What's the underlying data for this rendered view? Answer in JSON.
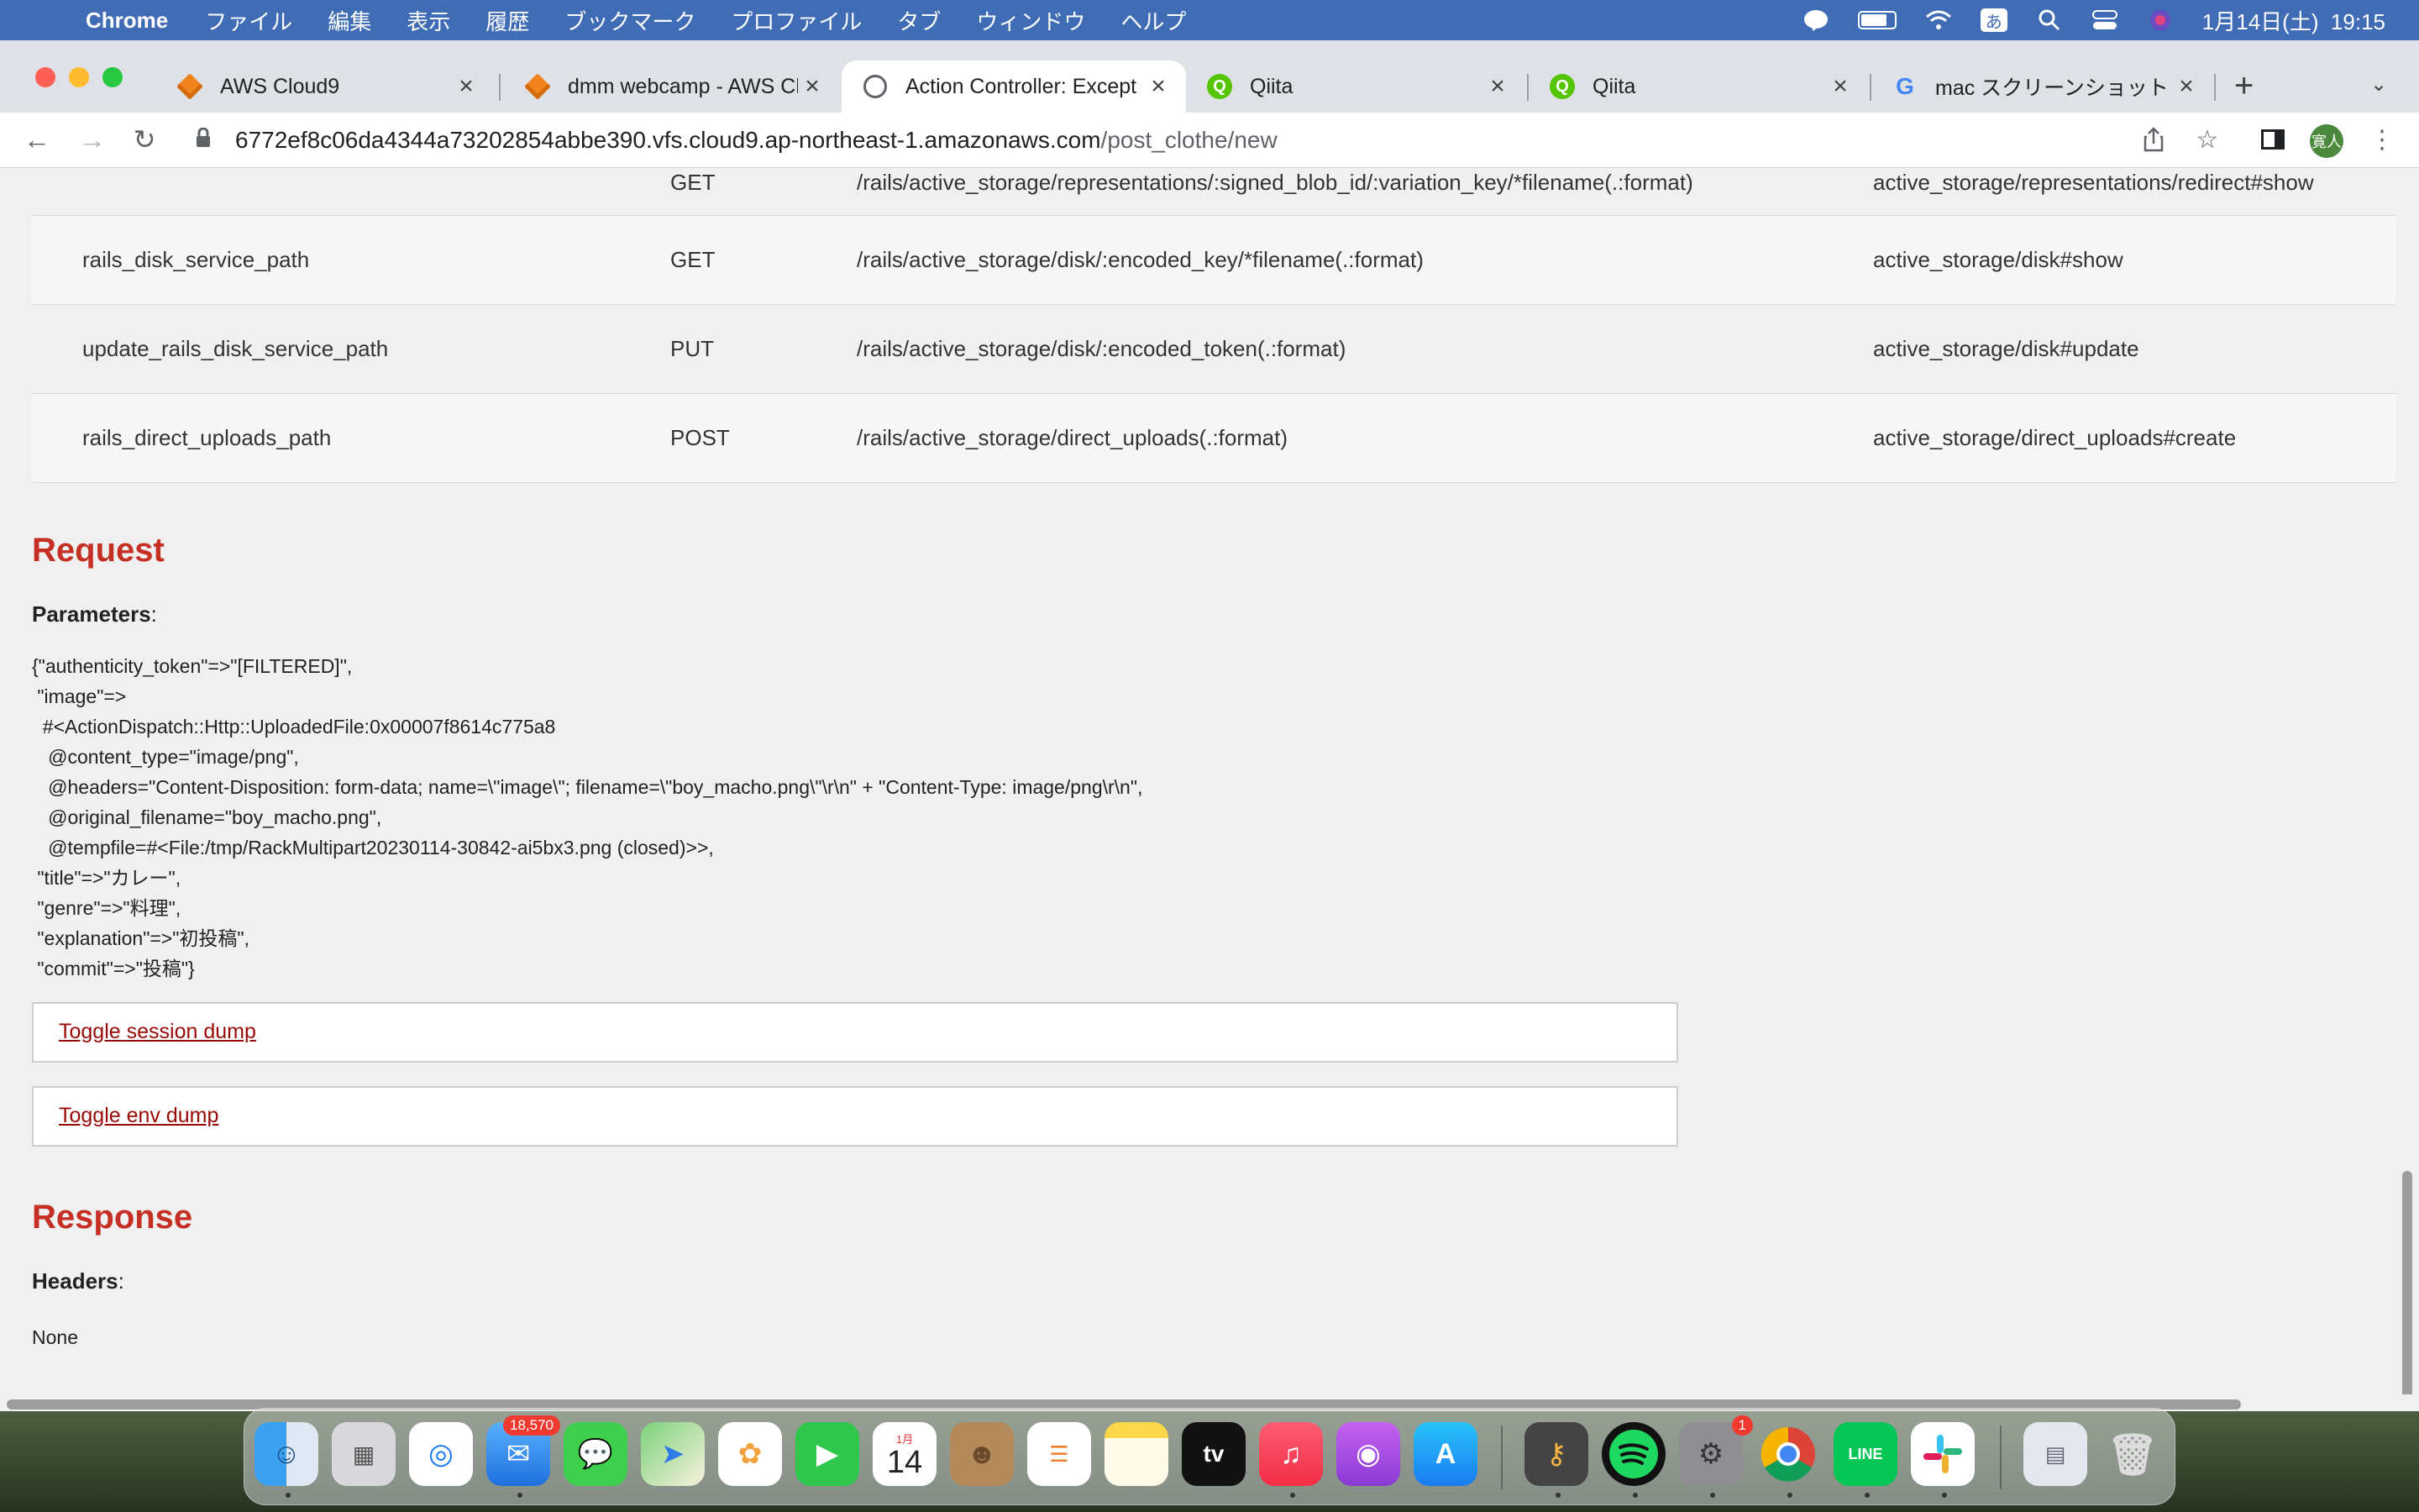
{
  "menubar": {
    "app": "Chrome",
    "items": [
      "ファイル",
      "編集",
      "表示",
      "履歴",
      "ブックマーク",
      "プロファイル",
      "タブ",
      "ウィンドウ",
      "ヘルプ"
    ],
    "ime": "あ",
    "datetime": "1月14日(土)  19:15"
  },
  "tabs": [
    {
      "label": "AWS Cloud9",
      "icon": "cloud9-icon"
    },
    {
      "label": "dmm webcamp - AWS Cl",
      "icon": "cloud9-icon"
    },
    {
      "label": "Action Controller: Except",
      "icon": "globe-icon"
    },
    {
      "label": "Qiita",
      "icon": "qiita-icon"
    },
    {
      "label": "Qiita",
      "icon": "qiita-icon"
    },
    {
      "label": "mac スクリーンショット -",
      "icon": "google-icon"
    }
  ],
  "omnibox": {
    "host": "6772ef8c06da4344a73202854abbe390.vfs.cloud9.ap-northeast-1.amazonaws.com",
    "path": "/post_clothe/new"
  },
  "profile_initials": "寛人",
  "routes": [
    {
      "helper": "",
      "verb": "GET",
      "path": "/rails/active_storage/representations/:signed_blob_id/:variation_key/*filename(.:format)",
      "action": "active_storage/representations/redirect#show"
    },
    {
      "helper": "rails_disk_service_path",
      "verb": "GET",
      "path": "/rails/active_storage/disk/:encoded_key/*filename(.:format)",
      "action": "active_storage/disk#show"
    },
    {
      "helper": "update_rails_disk_service_path",
      "verb": "PUT",
      "path": "/rails/active_storage/disk/:encoded_token(.:format)",
      "action": "active_storage/disk#update"
    },
    {
      "helper": "rails_direct_uploads_path",
      "verb": "POST",
      "path": "/rails/active_storage/direct_uploads(.:format)",
      "action": "active_storage/direct_uploads#create"
    }
  ],
  "request": {
    "heading": "Request",
    "params_label": "Parameters",
    "params_text": "{\"authenticity_token\"=>\"[FILTERED]\",\n \"image\"=>\n  #<ActionDispatch::Http::UploadedFile:0x00007f8614c775a8\n   @content_type=\"image/png\",\n   @headers=\"Content-Disposition: form-data; name=\\\"image\\\"; filename=\\\"boy_macho.png\\\"\\r\\n\" + \"Content-Type: image/png\\r\\n\",\n   @original_filename=\"boy_macho.png\",\n   @tempfile=#<File:/tmp/RackMultipart20230114-30842-ai5bx3.png (closed)>>,\n \"title\"=>\"カレー\",\n \"genre\"=>\"料理\",\n \"explanation\"=>\"初投稿\",\n \"commit\"=>\"投稿\"}",
    "toggle_session": "Toggle session dump",
    "toggle_env": "Toggle env dump"
  },
  "response": {
    "heading": "Response",
    "headers_label": "Headers",
    "headers_value": "None"
  },
  "dock": {
    "mail_badge": "18,570",
    "calendar_month": "1月",
    "calendar_day": "14",
    "settings_badge": "1",
    "tv_label": "tv"
  },
  "colors": {
    "menubar": "#3f6cb5",
    "heading_red": "#c52f24",
    "link_red": "#980905"
  }
}
